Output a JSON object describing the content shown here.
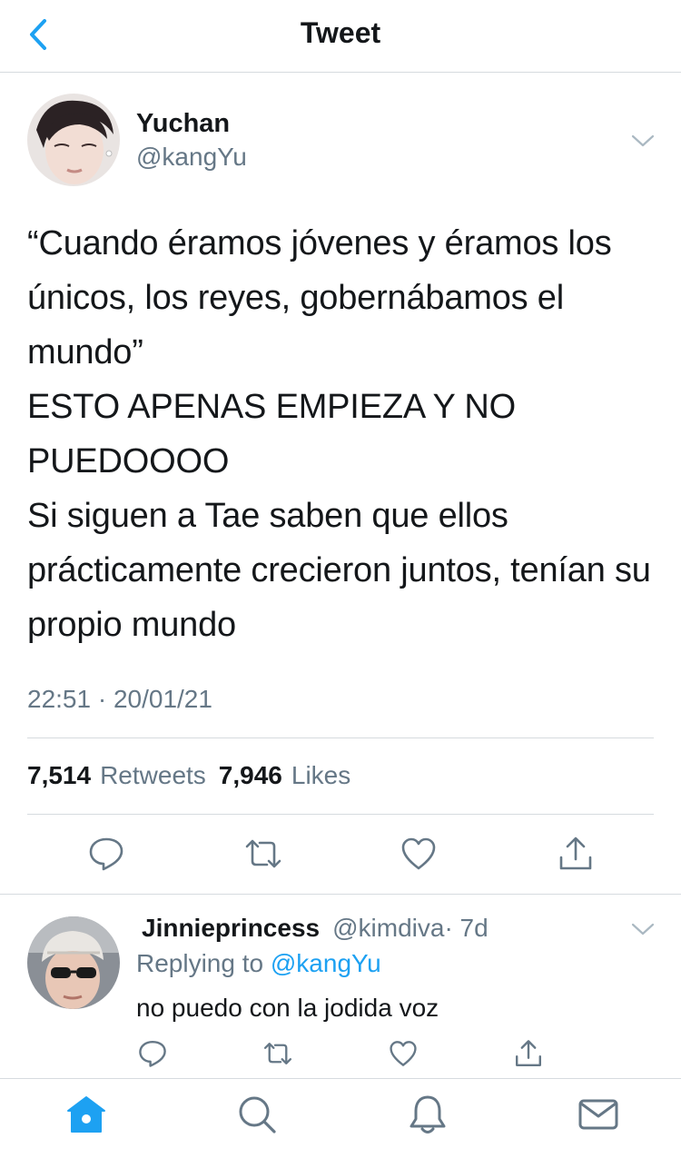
{
  "header": {
    "title": "Tweet"
  },
  "tweet": {
    "author_name": "Yuchan",
    "author_handle": "@kangYu",
    "text": "“Cuando éramos jóvenes y éramos los únicos, los reyes, gobernábamos el mundo”\nESTO APENAS EMPIEZA Y NO PUEDOOOO\nSi siguen a Tae saben que ellos prácticamente crecieron juntos, tenían su propio mundo",
    "timestamp": "22:51 · 20/01/21",
    "retweets_count": "7,514",
    "retweets_label": "Retweets",
    "likes_count": "7,946",
    "likes_label": "Likes"
  },
  "reply": {
    "author_name": "Jinnieprincess",
    "author_handle": "@kimdiva",
    "age": "· 7d",
    "replying_prefix": "Replying to",
    "replying_mention": "@kangYu",
    "text": "no puedo con la jodida voz"
  },
  "colors": {
    "accent": "#1da1f2",
    "muted": "#657786",
    "text": "#14171a",
    "divider": "#d6dbdf"
  },
  "icons": {
    "back": "chevron-left-icon",
    "reply": "comment-icon",
    "retweet": "retweet-icon",
    "like": "heart-icon",
    "share": "share-icon",
    "home": "home-icon",
    "search": "search-icon",
    "notifications": "bell-icon",
    "messages": "mail-icon"
  }
}
